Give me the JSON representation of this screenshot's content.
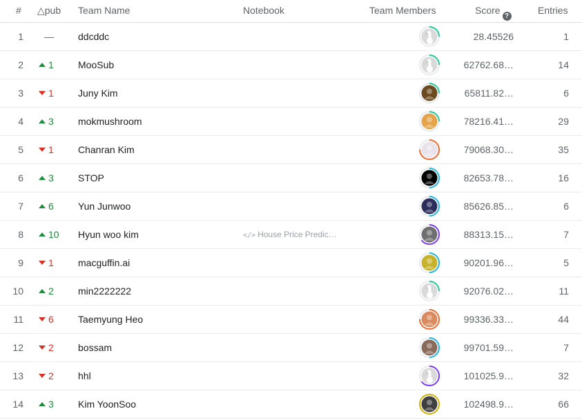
{
  "header": {
    "rank": "#",
    "delta": "△pub",
    "team_name": "Team Name",
    "notebook": "Notebook",
    "team_members": "Team Members",
    "score": "Score",
    "entries": "Entries",
    "score_help_icon": "question-circle-icon"
  },
  "rows": [
    {
      "rank": "1",
      "delta_dir": "same",
      "delta": "—",
      "team": "ddcddc",
      "notebook": "",
      "avatar_ring": "#20c997",
      "avatar_fill": "#d9d9d9",
      "avatar_icon": "goose-default-icon",
      "ring_portion": 0.25,
      "score": "28.45526",
      "entries": "1"
    },
    {
      "rank": "2",
      "delta_dir": "up",
      "delta": "1",
      "team": "MooSub",
      "notebook": "",
      "avatar_ring": "#20c997",
      "avatar_fill": "#d9d9d9",
      "avatar_icon": "goose-default-icon",
      "ring_portion": 0.25,
      "score": "62762.68…",
      "entries": "14"
    },
    {
      "rank": "3",
      "delta_dir": "down",
      "delta": "1",
      "team": "Juny Kim",
      "notebook": "",
      "avatar_ring": "#20c997",
      "avatar_fill": "#6b4a1f",
      "avatar_icon": "photo-avatar-icon",
      "ring_portion": 0.25,
      "score": "65811.82…",
      "entries": "6"
    },
    {
      "rank": "4",
      "delta_dir": "up",
      "delta": "3",
      "team": "mokmushroom",
      "notebook": "",
      "avatar_ring": "#20c997",
      "avatar_fill": "#e5a34a",
      "avatar_icon": "photo-avatar-icon",
      "ring_portion": 0.25,
      "score": "78216.41…",
      "entries": "29"
    },
    {
      "rank": "5",
      "delta_dir": "down",
      "delta": "1",
      "team": "Chanran Kim",
      "notebook": "",
      "avatar_ring": "#ef6c2e",
      "avatar_fill": "#e9e2ea",
      "avatar_icon": "photo-avatar-icon",
      "ring_portion": 0.75,
      "score": "79068.30…",
      "entries": "35"
    },
    {
      "rank": "6",
      "delta_dir": "up",
      "delta": "3",
      "team": "STOP",
      "notebook": "",
      "avatar_ring": "#1fb6e0",
      "avatar_fill": "#000000",
      "avatar_icon": "photo-avatar-icon",
      "ring_portion": 0.5,
      "score": "82653.78…",
      "entries": "16"
    },
    {
      "rank": "7",
      "delta_dir": "up",
      "delta": "6",
      "team": "Yun Junwoo",
      "notebook": "",
      "avatar_ring": "#1fb6e0",
      "avatar_fill": "#2b2d5a",
      "avatar_icon": "photo-avatar-icon",
      "ring_portion": 0.5,
      "score": "85626.85…",
      "entries": "6"
    },
    {
      "rank": "8",
      "delta_dir": "up",
      "delta": "10",
      "team": "Hyun woo kim",
      "notebook": "House Price Predic…",
      "avatar_ring": "#7b3ff2",
      "avatar_fill": "#6f6f6f",
      "avatar_icon": "photo-avatar-icon",
      "ring_portion": 0.65,
      "score": "88313.15…",
      "entries": "7"
    },
    {
      "rank": "9",
      "delta_dir": "down",
      "delta": "1",
      "team": "macguffin.ai",
      "notebook": "",
      "avatar_ring": "#1fb6e0",
      "avatar_fill": "#c6b22b",
      "avatar_icon": "photo-avatar-icon",
      "ring_portion": 0.5,
      "score": "90201.96…",
      "entries": "5"
    },
    {
      "rank": "10",
      "delta_dir": "up",
      "delta": "2",
      "team": "min2222222",
      "notebook": "",
      "avatar_ring": "#20c997",
      "avatar_fill": "#d9d9d9",
      "avatar_icon": "goose-default-icon",
      "ring_portion": 0.25,
      "score": "92076.02…",
      "entries": "11"
    },
    {
      "rank": "11",
      "delta_dir": "down",
      "delta": "6",
      "team": "Taemyung Heo",
      "notebook": "",
      "avatar_ring": "#ef6c2e",
      "avatar_fill": "#d98b5f",
      "avatar_icon": "photo-avatar-icon",
      "ring_portion": 0.75,
      "score": "99336.33…",
      "entries": "44"
    },
    {
      "rank": "12",
      "delta_dir": "down",
      "delta": "2",
      "team": "bossam",
      "notebook": "",
      "avatar_ring": "#1fb6e0",
      "avatar_fill": "#8a6a5a",
      "avatar_icon": "photo-avatar-icon",
      "ring_portion": 0.5,
      "score": "99701.59…",
      "entries": "7"
    },
    {
      "rank": "13",
      "delta_dir": "down",
      "delta": "2",
      "team": "hhl",
      "notebook": "",
      "avatar_ring": "#7b3ff2",
      "avatar_fill": "#d9d9d9",
      "avatar_icon": "goose-default-icon",
      "ring_portion": 0.65,
      "score": "101025.9…",
      "entries": "32"
    },
    {
      "rank": "14",
      "delta_dir": "up",
      "delta": "3",
      "team": "Kim YoonSoo",
      "notebook": "",
      "avatar_ring": "#d4b106",
      "avatar_fill": "#3f3f3f",
      "avatar_icon": "photo-avatar-icon",
      "ring_portion": 1.0,
      "score": "102498.9…",
      "entries": "66"
    }
  ]
}
